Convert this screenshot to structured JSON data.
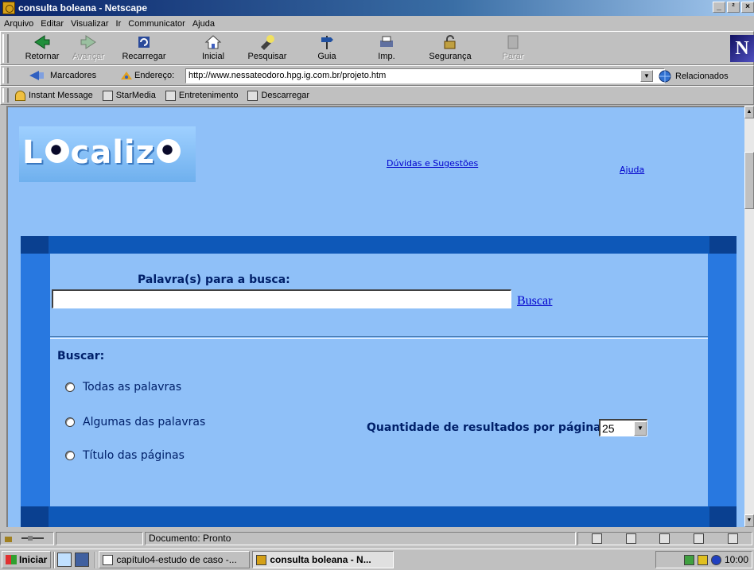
{
  "window": {
    "title": "consulta boleana - Netscape",
    "controls": [
      "_",
      "²",
      "×"
    ]
  },
  "menu": [
    "Arquivo",
    "Editar",
    "Visualizar",
    "Ir",
    "Communicator",
    "Ajuda"
  ],
  "nav": {
    "back": "Retornar",
    "forward": "Avançar",
    "reload": "Recarregar",
    "home": "Inicial",
    "search": "Pesquisar",
    "guide": "Guia",
    "print": "Imp.",
    "security": "Segurança",
    "stop": "Parar",
    "logo": "N"
  },
  "location": {
    "bookmarks": "Marcadores",
    "address_label": "Endereço:",
    "url": "http://www.nessateodoro.hpg.ig.com.br/projeto.htm",
    "related": "Relacionados"
  },
  "personal": [
    "Instant Message",
    "StarMedia",
    "Entretenimento",
    "Descarregar"
  ],
  "page": {
    "logo": "Localizo",
    "logo_parts": [
      "L",
      "caliz"
    ],
    "link_help": "Dúvidas e Sugestões",
    "link_ajuda": "Ajuda",
    "search_label": "Palavra(s) para a busca:",
    "search_value": "",
    "search_button": "Buscar",
    "options_label": "Buscar:",
    "options": [
      "Todas as palavras",
      "Algumas das palavras",
      "Título das páginas"
    ],
    "qty_label": "Quantidade de resultados por página:",
    "qty_value": "25"
  },
  "status": {
    "text": "Documento: Pronto"
  },
  "taskbar": {
    "start": "Iniciar",
    "tasks": [
      "capítulo4-estudo de caso -...",
      "consulta boleana - N..."
    ],
    "clock": "10:00"
  },
  "colors": {
    "page_bg": "#8fc0f8",
    "frame_dark": "#0e58b8",
    "frame_side": "#2878e0",
    "label_text": "#00206a",
    "link": "#0000cc"
  }
}
